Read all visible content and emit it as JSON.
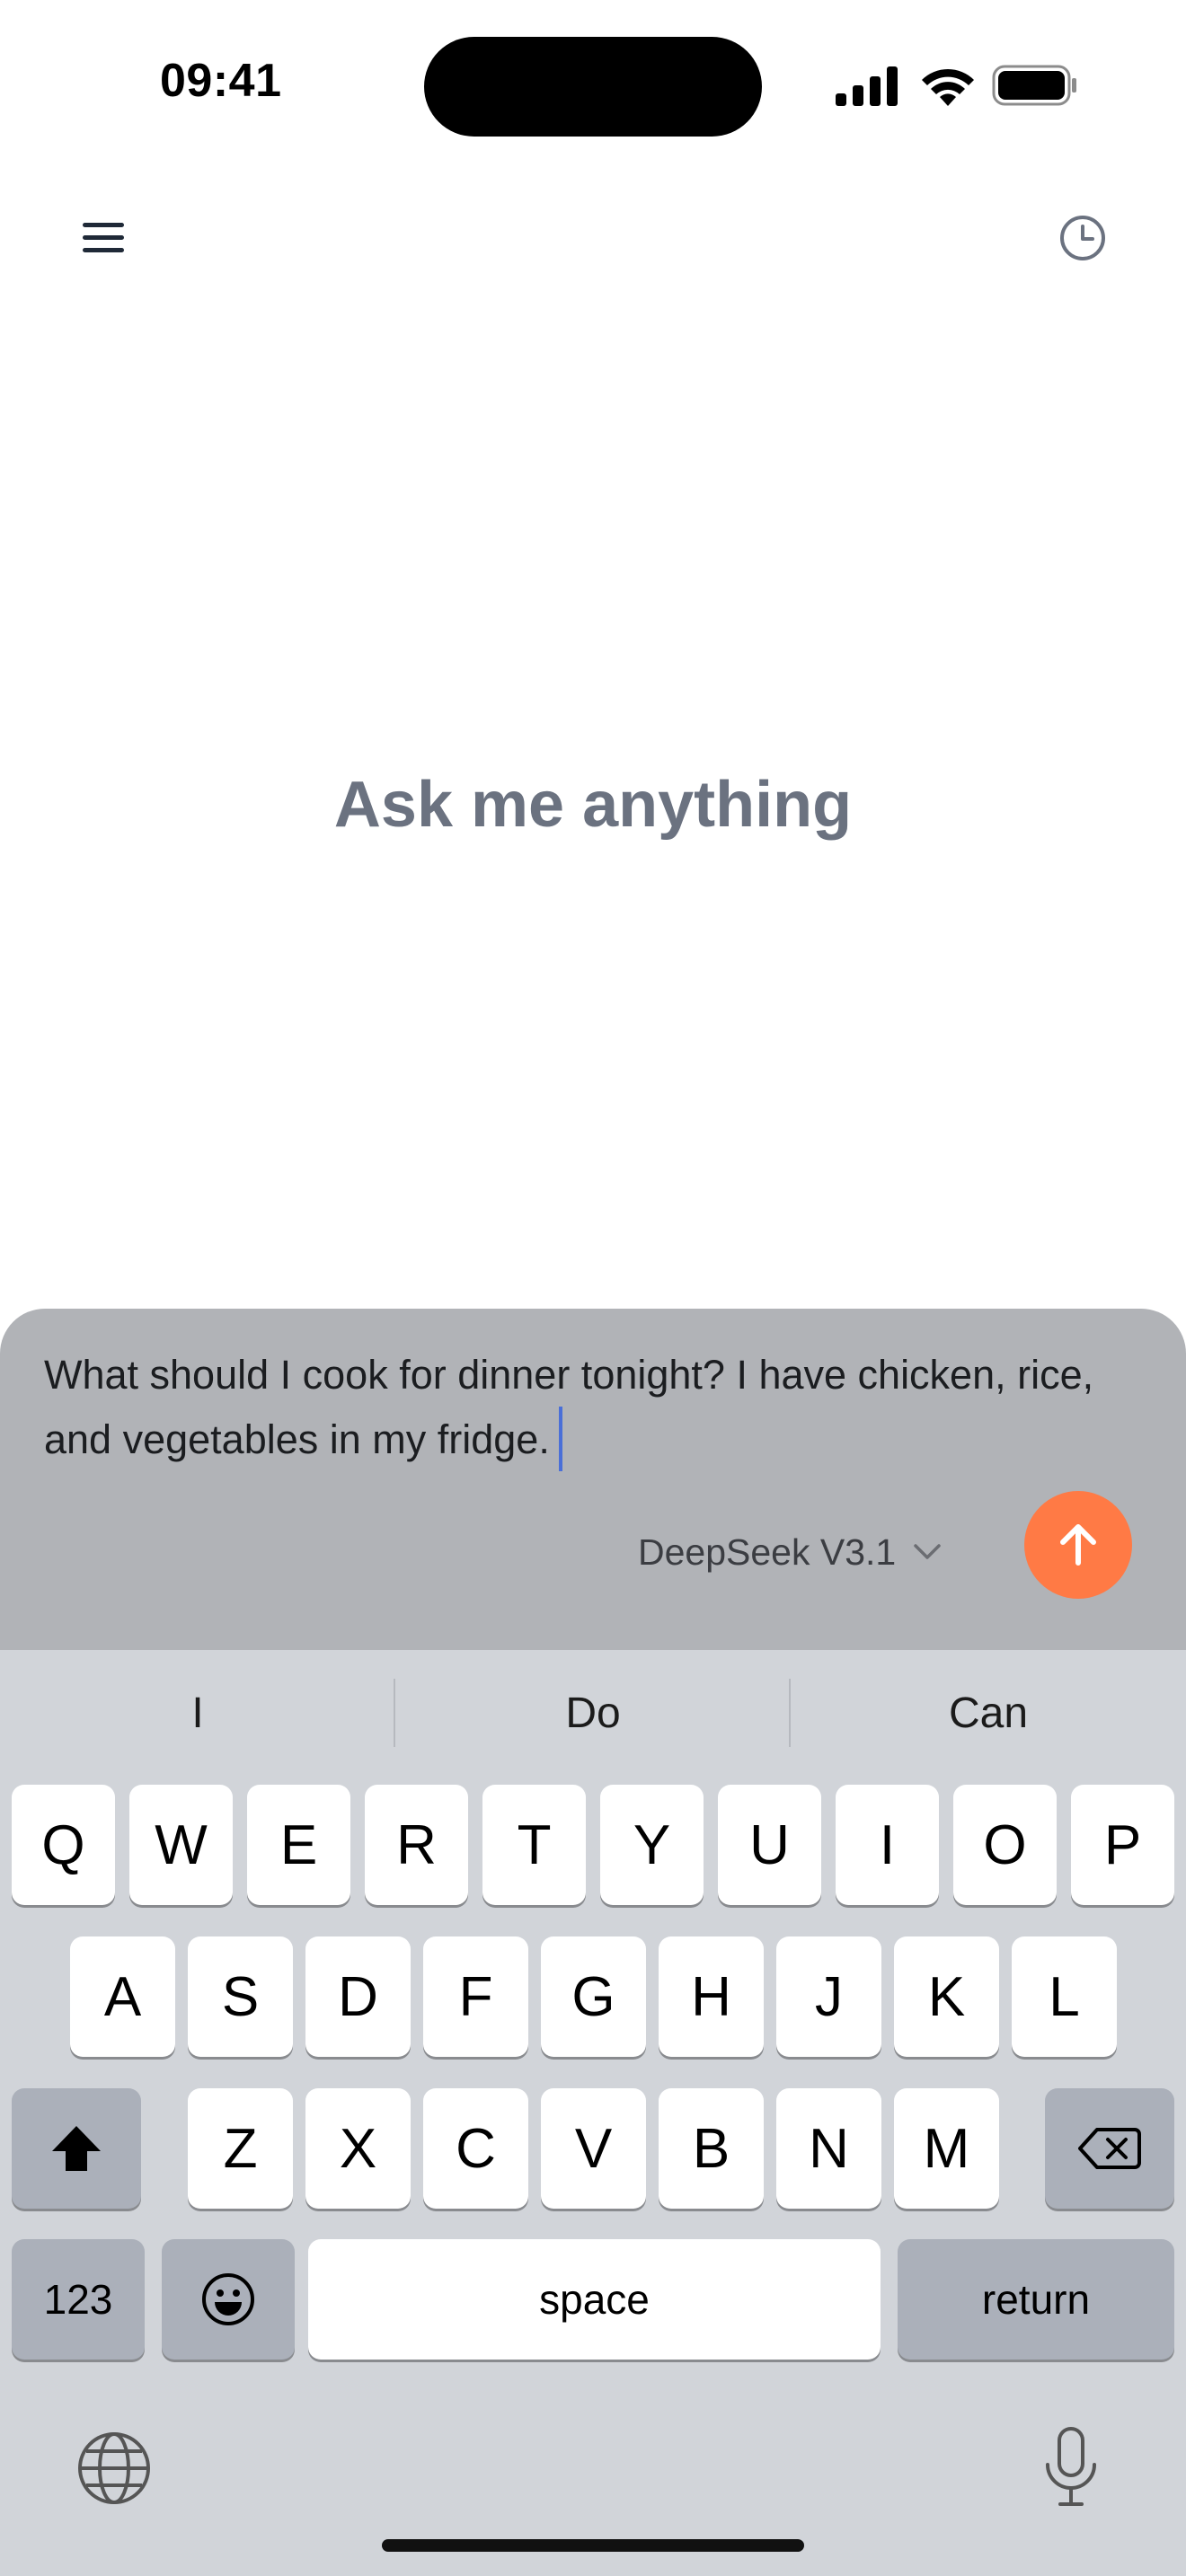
{
  "status_bar": {
    "time": "09:41",
    "icons": [
      "signal-icon",
      "wifi-icon",
      "battery-icon"
    ]
  },
  "top_bar": {
    "menu_icon": "menu-icon",
    "history_icon": "clock-icon"
  },
  "main": {
    "empty_state_text": "Ask me anything"
  },
  "composer": {
    "input_value": "What should I cook for dinner tonight? I have chicken, rice, and vegetables in my fridge.",
    "model_label": "DeepSeek V3.1",
    "send_icon": "arrow-up-icon",
    "accent_color": "#ff7a45"
  },
  "keyboard": {
    "suggestions": [
      "I",
      "Do",
      "Can"
    ],
    "row1": [
      "Q",
      "W",
      "E",
      "R",
      "T",
      "Y",
      "U",
      "I",
      "O",
      "P"
    ],
    "row2": [
      "A",
      "S",
      "D",
      "F",
      "G",
      "H",
      "J",
      "K",
      "L"
    ],
    "row3": [
      "Z",
      "X",
      "C",
      "V",
      "B",
      "N",
      "M"
    ],
    "numbers_label": "123",
    "space_label": "space",
    "return_label": "return"
  }
}
